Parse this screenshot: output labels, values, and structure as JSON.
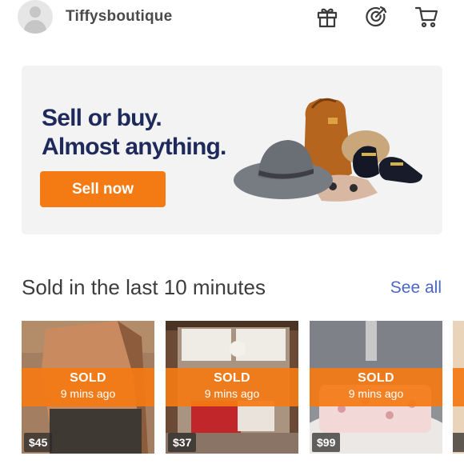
{
  "header": {
    "username": "Tiffysboutique",
    "icons": [
      "gift-icon",
      "target-icon",
      "cart-icon"
    ]
  },
  "banner": {
    "title_line1": "Sell or buy.",
    "title_line2": "Almost anything.",
    "button_label": "Sell now"
  },
  "section": {
    "title": "Sold in the last 10 minutes",
    "see_all": "See all"
  },
  "cards": [
    {
      "status": "SOLD",
      "time": "9 mins ago",
      "price": "$45"
    },
    {
      "status": "SOLD",
      "time": "9 mins ago",
      "price": "$37"
    },
    {
      "status": "SOLD",
      "time": "9 mins ago",
      "price": "$99"
    }
  ],
  "colors": {
    "accent": "#f47a14",
    "banner_title": "#1f2a5c",
    "link": "#4a67c8",
    "banner_bg": "#f3f3f3"
  }
}
